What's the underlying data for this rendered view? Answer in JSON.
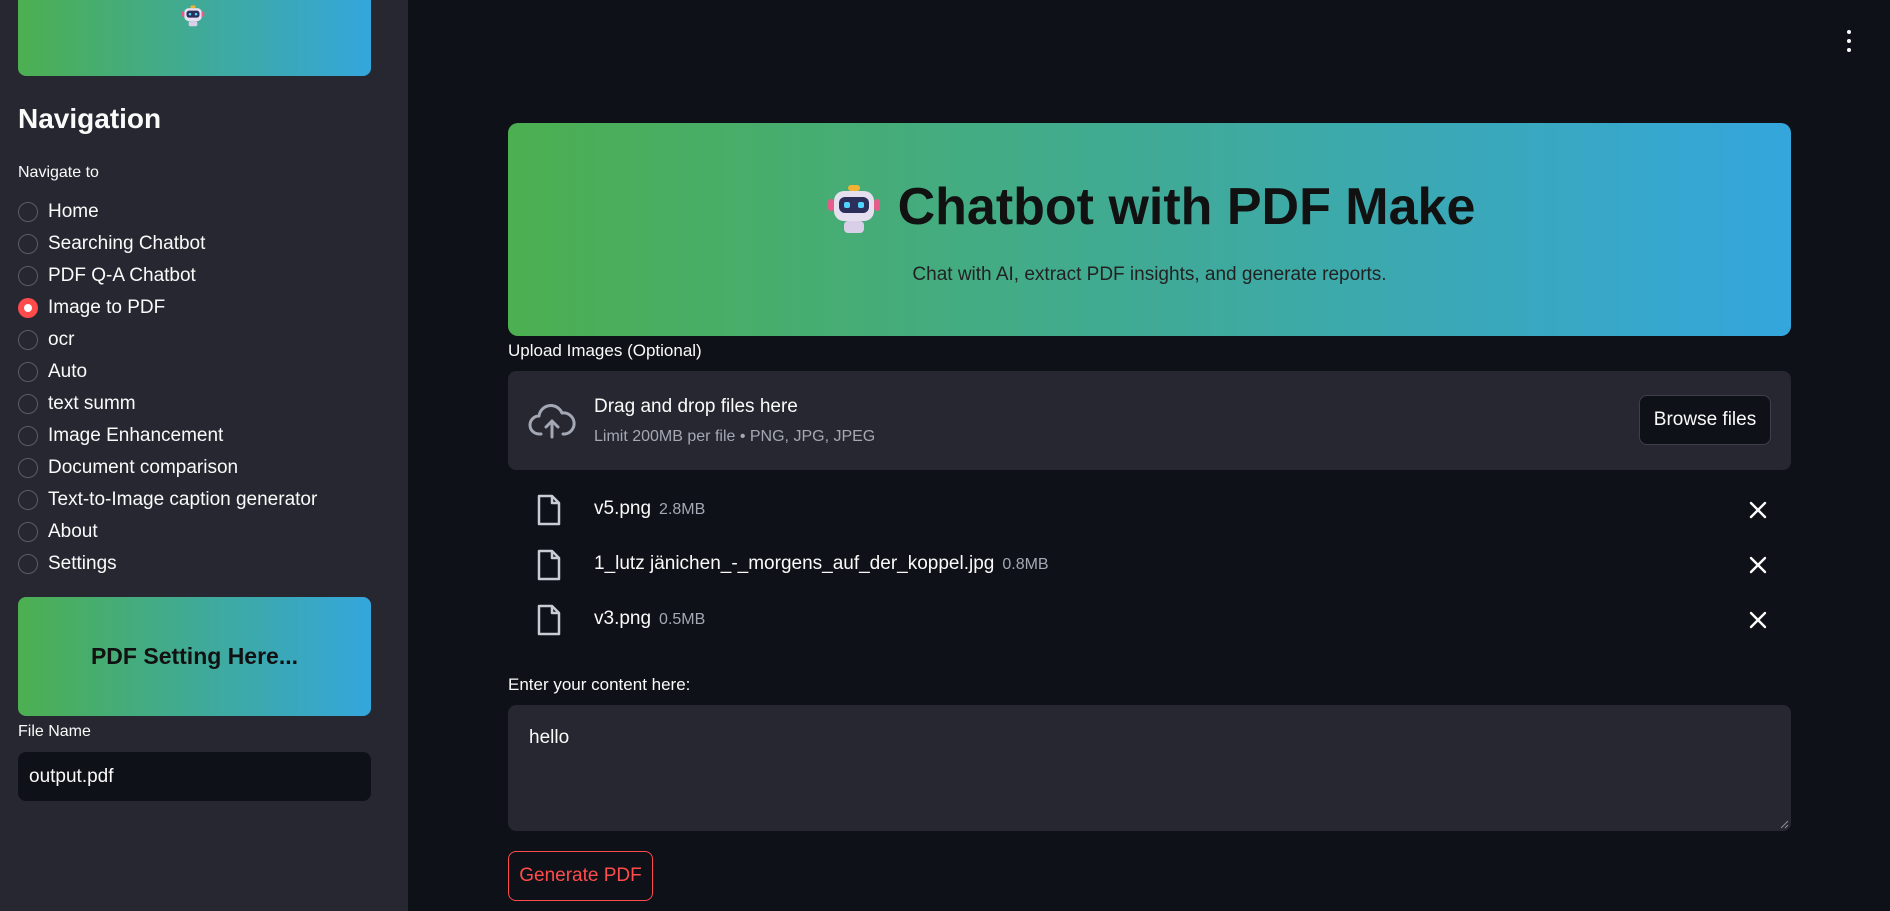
{
  "sidebar": {
    "heading": "Navigation",
    "nav_label": "Navigate to",
    "nav_items": [
      {
        "label": "Home",
        "selected": false
      },
      {
        "label": "Searching Chatbot",
        "selected": false
      },
      {
        "label": "PDF Q-A Chatbot",
        "selected": false
      },
      {
        "label": "Image to PDF",
        "selected": true
      },
      {
        "label": "ocr",
        "selected": false
      },
      {
        "label": "Auto",
        "selected": false
      },
      {
        "label": "text summ",
        "selected": false
      },
      {
        "label": "Image Enhancement",
        "selected": false
      },
      {
        "label": "Document comparison",
        "selected": false
      },
      {
        "label": "Text-to-Image caption generator",
        "selected": false
      },
      {
        "label": "About",
        "selected": false
      },
      {
        "label": "Settings",
        "selected": false
      }
    ],
    "pdf_setting_title": "PDF Setting Here...",
    "file_name_label": "File Name",
    "file_name_value": "output.pdf"
  },
  "hero": {
    "title": "Chatbot with PDF Make",
    "subtitle": "Chat with AI, extract PDF insights, and generate reports."
  },
  "uploader": {
    "label": "Upload Images (Optional)",
    "drop_title": "Drag and drop files here",
    "drop_sub": "Limit 200MB per file • PNG, JPG, JPEG",
    "browse_label": "Browse files",
    "files": [
      {
        "name": "v5.png",
        "size": "2.8MB"
      },
      {
        "name": "1_lutz jänichen_-_morgens_auf_der_koppel.jpg",
        "size": "0.8MB"
      },
      {
        "name": "v3.png",
        "size": "0.5MB"
      }
    ]
  },
  "content": {
    "label": "Enter your content here:",
    "value": "hello"
  },
  "actions": {
    "generate_label": "Generate PDF"
  },
  "colors": {
    "accent": "#ff4b4b",
    "gradient_start": "#4caf50",
    "gradient_end": "#34a6dc",
    "background": "#0e1117",
    "sidebar": "#262730"
  },
  "icons": {
    "menu": "kebab-menu-icon",
    "upload": "cloud-upload-icon",
    "file": "file-icon",
    "remove": "close-icon",
    "mascot": "robot-icon"
  }
}
